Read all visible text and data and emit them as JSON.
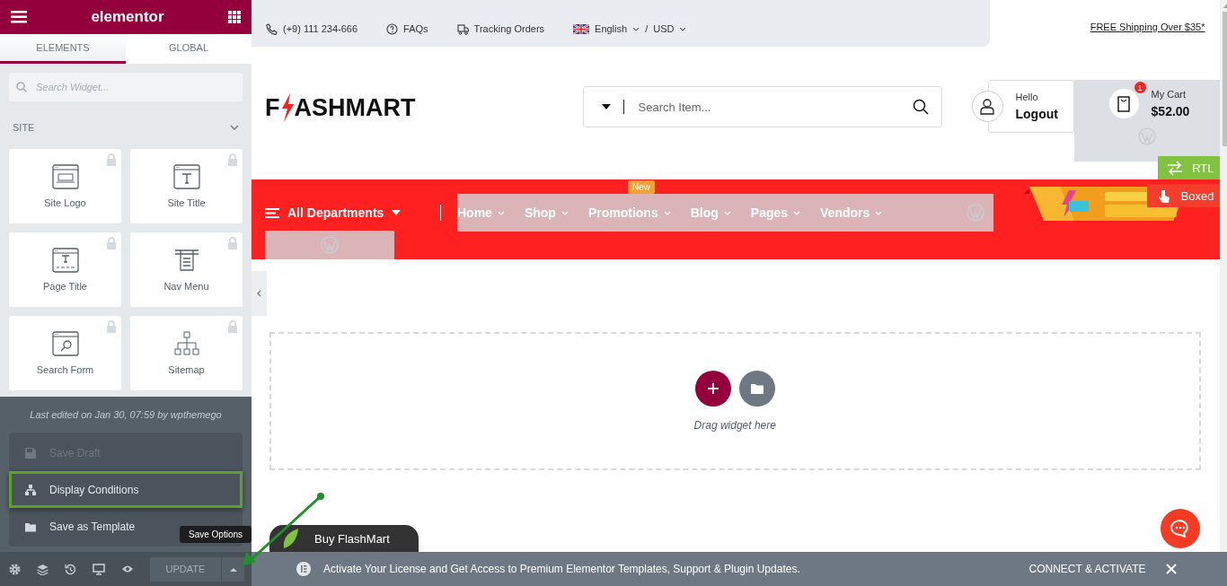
{
  "panel": {
    "title": "elementor",
    "tabs": [
      {
        "label": "ELEMENTS",
        "selected": true
      },
      {
        "label": "GLOBAL",
        "selected": false
      }
    ],
    "search": {
      "placeholder": "Search Widget..."
    },
    "category": {
      "label": "SITE",
      "expanded": true
    },
    "widgets": [
      {
        "kind": "logo",
        "label": "Site Logo",
        "locked": true
      },
      {
        "kind": "title",
        "label": "Site Title",
        "locked": true
      },
      {
        "kind": "page-title",
        "label": "Page Title",
        "locked": true
      },
      {
        "kind": "nav",
        "label": "Nav Menu",
        "locked": true
      },
      {
        "kind": "search",
        "label": "Search Form",
        "locked": true
      },
      {
        "kind": "sitemap",
        "label": "Sitemap",
        "locked": true
      }
    ],
    "save_menu": {
      "note": "Last edited on Jan 30, 07:59 by wpthemego",
      "items": [
        {
          "kind": "draft",
          "label": "Save Draft",
          "disabled": true,
          "selected": false
        },
        {
          "kind": "conditions",
          "label": "Display Conditions",
          "disabled": false,
          "selected": true
        },
        {
          "kind": "template",
          "label": "Save as Template",
          "disabled": false,
          "selected": false
        }
      ]
    },
    "update_label": "UPDATE",
    "tooltip": "Save Options"
  },
  "site": {
    "topbar": {
      "phone": "(+9) 111 234-666",
      "faq": "FAQs",
      "tracking": "Tracking Orders",
      "language": "English",
      "separator": "/",
      "currency": "USD",
      "shipping": "FREE Shipping Over $35*"
    },
    "logo": {
      "before": "F",
      "after": "ASHMART"
    },
    "search": {
      "placeholder": "Search Item..."
    },
    "account": {
      "greeting": "Hello",
      "action": "Logout"
    },
    "cart": {
      "label": "My Cart",
      "total": "$52.00",
      "count": "1"
    },
    "nav": {
      "departments": "All Departments",
      "items": [
        {
          "label": "Home"
        },
        {
          "label": "Shop"
        },
        {
          "label": "Promotions",
          "badge": "New"
        },
        {
          "label": "Blog"
        },
        {
          "label": "Pages"
        },
        {
          "label": "Vendors"
        }
      ]
    },
    "side_buttons": [
      {
        "kind": "rtl",
        "label": "RTL",
        "color": "#81c340"
      },
      {
        "kind": "boxed",
        "label": "Boxed",
        "color": "#f53d2d"
      }
    ],
    "dropzone": {
      "hint": "Drag widget here"
    },
    "buy_button": "Buy FlashMart"
  },
  "notice": {
    "message": "Activate Your License and Get Access to Premium Elementor Templates, Support & Plugin Updates.",
    "action": "CONNECT & ACTIVATE"
  }
}
